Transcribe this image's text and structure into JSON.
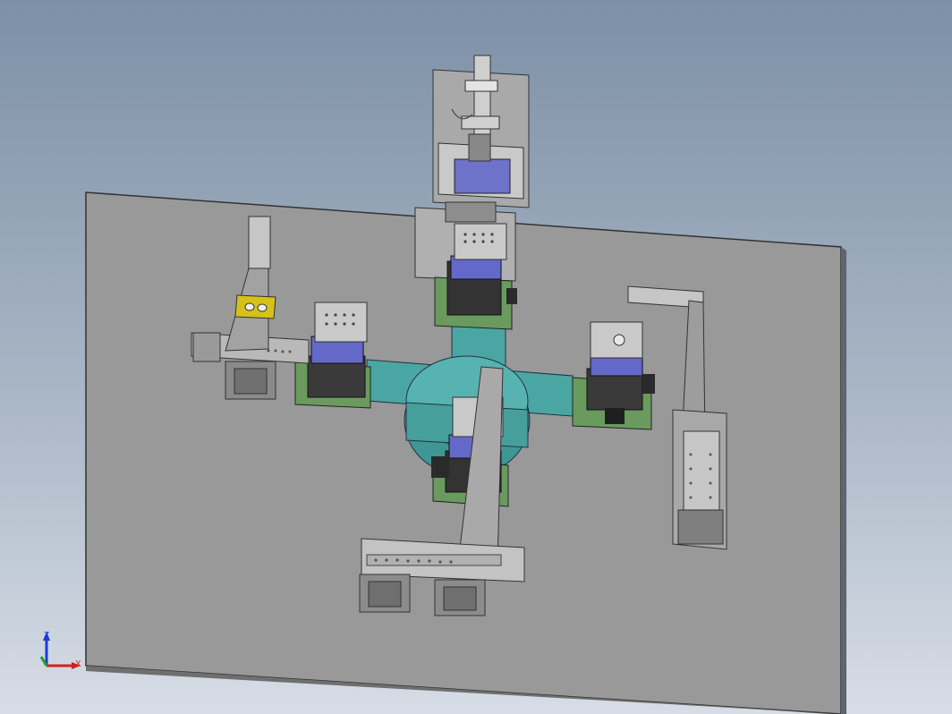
{
  "viewport": {
    "background_top": "#7d90a6",
    "background_bottom": "#d7dde6"
  },
  "model": {
    "plate_color": "#9b9b9b",
    "hub_color": "#4aa6a3",
    "pcb_color": "#5d8a5a",
    "motor_color": "#5f66c8",
    "rail_color": "#b7b7b7",
    "bracket_color": "#d4c21a"
  },
  "triad": {
    "z_label": "Z",
    "x_label": "X",
    "z_color": "#1a3bd6",
    "x_color": "#d21f1f",
    "y_color": "#1f9d2a"
  }
}
